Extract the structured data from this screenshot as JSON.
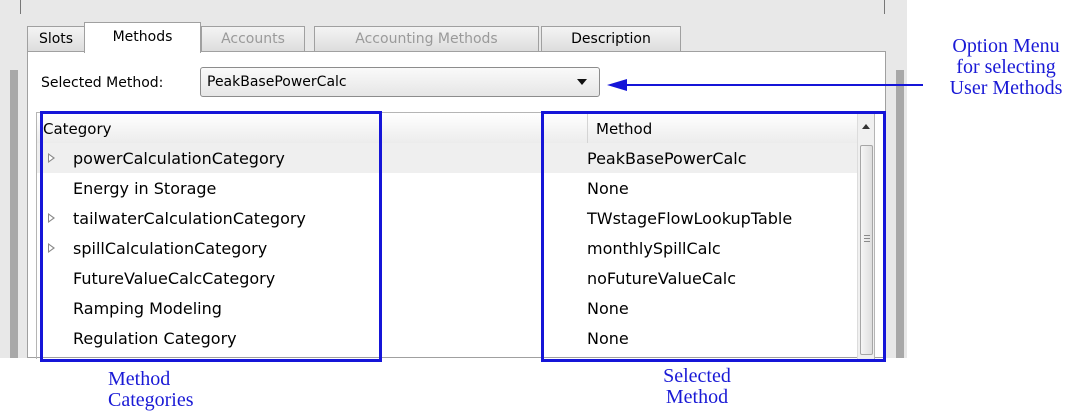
{
  "tabs": [
    {
      "label": "Slots",
      "state": "normal"
    },
    {
      "label": "Methods",
      "state": "active"
    },
    {
      "label": "Accounts",
      "state": "disabled"
    },
    {
      "label": "Accounting Methods",
      "state": "disabled"
    },
    {
      "label": "Description",
      "state": "normal"
    }
  ],
  "selector": {
    "label": "Selected Method:",
    "value": "PeakBasePowerCalc"
  },
  "table": {
    "headers": {
      "category": "Category",
      "method": "Method"
    },
    "rows": [
      {
        "category": "powerCalculationCategory",
        "method": "PeakBasePowerCalc",
        "expandable": true,
        "selected": true
      },
      {
        "category": "Energy in Storage",
        "method": "None",
        "expandable": false,
        "selected": false
      },
      {
        "category": "tailwaterCalculationCategory",
        "method": "TWstageFlowLookupTable",
        "expandable": true,
        "selected": false
      },
      {
        "category": "spillCalculationCategory",
        "method": "monthlySpillCalc",
        "expandable": true,
        "selected": false
      },
      {
        "category": "FutureValueCalcCategory",
        "method": "noFutureValueCalc",
        "expandable": false,
        "selected": false
      },
      {
        "category": "Ramping Modeling",
        "method": "None",
        "expandable": false,
        "selected": false
      },
      {
        "category": "Regulation Category",
        "method": "None",
        "expandable": false,
        "selected": false
      }
    ]
  },
  "annotations": {
    "option_menu": [
      "Option Menu",
      "for selecting",
      "User Methods"
    ],
    "method_categories": [
      "Method",
      "Categories"
    ],
    "selected_method": [
      "Selected",
      "Method"
    ]
  },
  "colors": {
    "annotation": "#1515d8",
    "selected_row": "#efefef"
  }
}
